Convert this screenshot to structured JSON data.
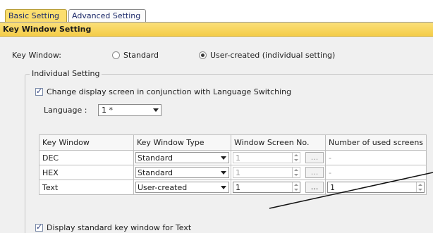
{
  "tabs": [
    {
      "label": "Basic Setting"
    },
    {
      "label": "Advanced Setting"
    }
  ],
  "section": {
    "title": "Key Window Setting"
  },
  "key_window": {
    "label": "Key Window:",
    "options": [
      {
        "label": "Standard",
        "selected": false
      },
      {
        "label": "User-created (individual setting)",
        "selected": true
      }
    ]
  },
  "individual": {
    "group_title": "Individual Setting",
    "change_display_label": "Change display screen in conjunction with Language Switching",
    "change_display_checked": true,
    "language_label": "Language :",
    "language_value": "1  *"
  },
  "table": {
    "headers": [
      "Key Window",
      "Key Window Type",
      "Window Screen No.",
      "Number of used screens"
    ],
    "rows": [
      {
        "key_window": "DEC",
        "type": "Standard",
        "screen_no": "1",
        "ellipsis": "...",
        "used": "-"
      },
      {
        "key_window": "HEX",
        "type": "Standard",
        "screen_no": "1",
        "ellipsis": "...",
        "used": "-"
      },
      {
        "key_window": "Text",
        "type": "User-created",
        "screen_no": "1",
        "ellipsis": "...",
        "used": "1"
      }
    ]
  },
  "footer": {
    "display_standard_label": "Display standard key window for Text",
    "display_standard_checked": true
  },
  "colors": {
    "accent": "#f4cc48",
    "tab_active": "#fbde6e"
  }
}
